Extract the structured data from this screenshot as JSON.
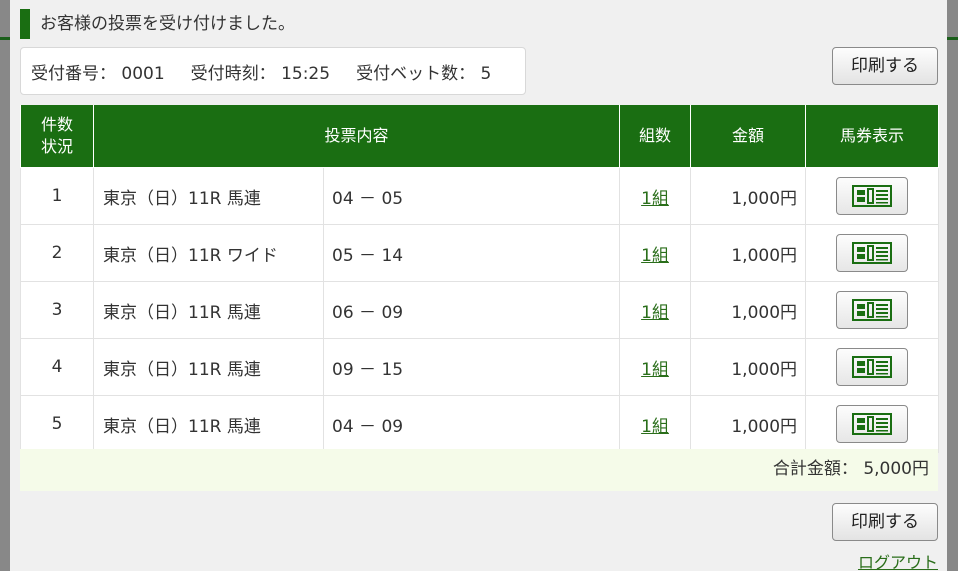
{
  "notice": "お客様の投票を受け付けました。",
  "receipt": {
    "number": "受付番号： 0001",
    "time": "受付時刻： 15:25",
    "bet_count": "受付ベット数： 5"
  },
  "print_label": "印刷する",
  "table": {
    "headers": {
      "count_line1": "件数",
      "count_line2": "状況",
      "content": "投票内容",
      "kumi": "組数",
      "amount": "金額",
      "ticket": "馬券表示"
    },
    "rows": [
      {
        "num": "1",
        "race": "東京（日）11R 馬連",
        "combo": "04 － 05",
        "kumi": "1組",
        "amount": "1,000円"
      },
      {
        "num": "2",
        "race": "東京（日）11R ワイド",
        "combo": "05 － 14",
        "kumi": "1組",
        "amount": "1,000円"
      },
      {
        "num": "3",
        "race": "東京（日）11R 馬連",
        "combo": "06 － 09",
        "kumi": "1組",
        "amount": "1,000円"
      },
      {
        "num": "4",
        "race": "東京（日）11R 馬連",
        "combo": "09 － 15",
        "kumi": "1組",
        "amount": "1,000円"
      },
      {
        "num": "5",
        "race": "東京（日）11R 馬連",
        "combo": "04 － 09",
        "kumi": "1組",
        "amount": "1,000円"
      }
    ]
  },
  "total": "合計金額： 5,000円",
  "logout": "ログアウト",
  "icons": {
    "ticket": "ticket-icon"
  },
  "colors": {
    "accent": "#1a6e12",
    "total_bg": "#f5fbe9",
    "link": "#2a6e1a"
  }
}
